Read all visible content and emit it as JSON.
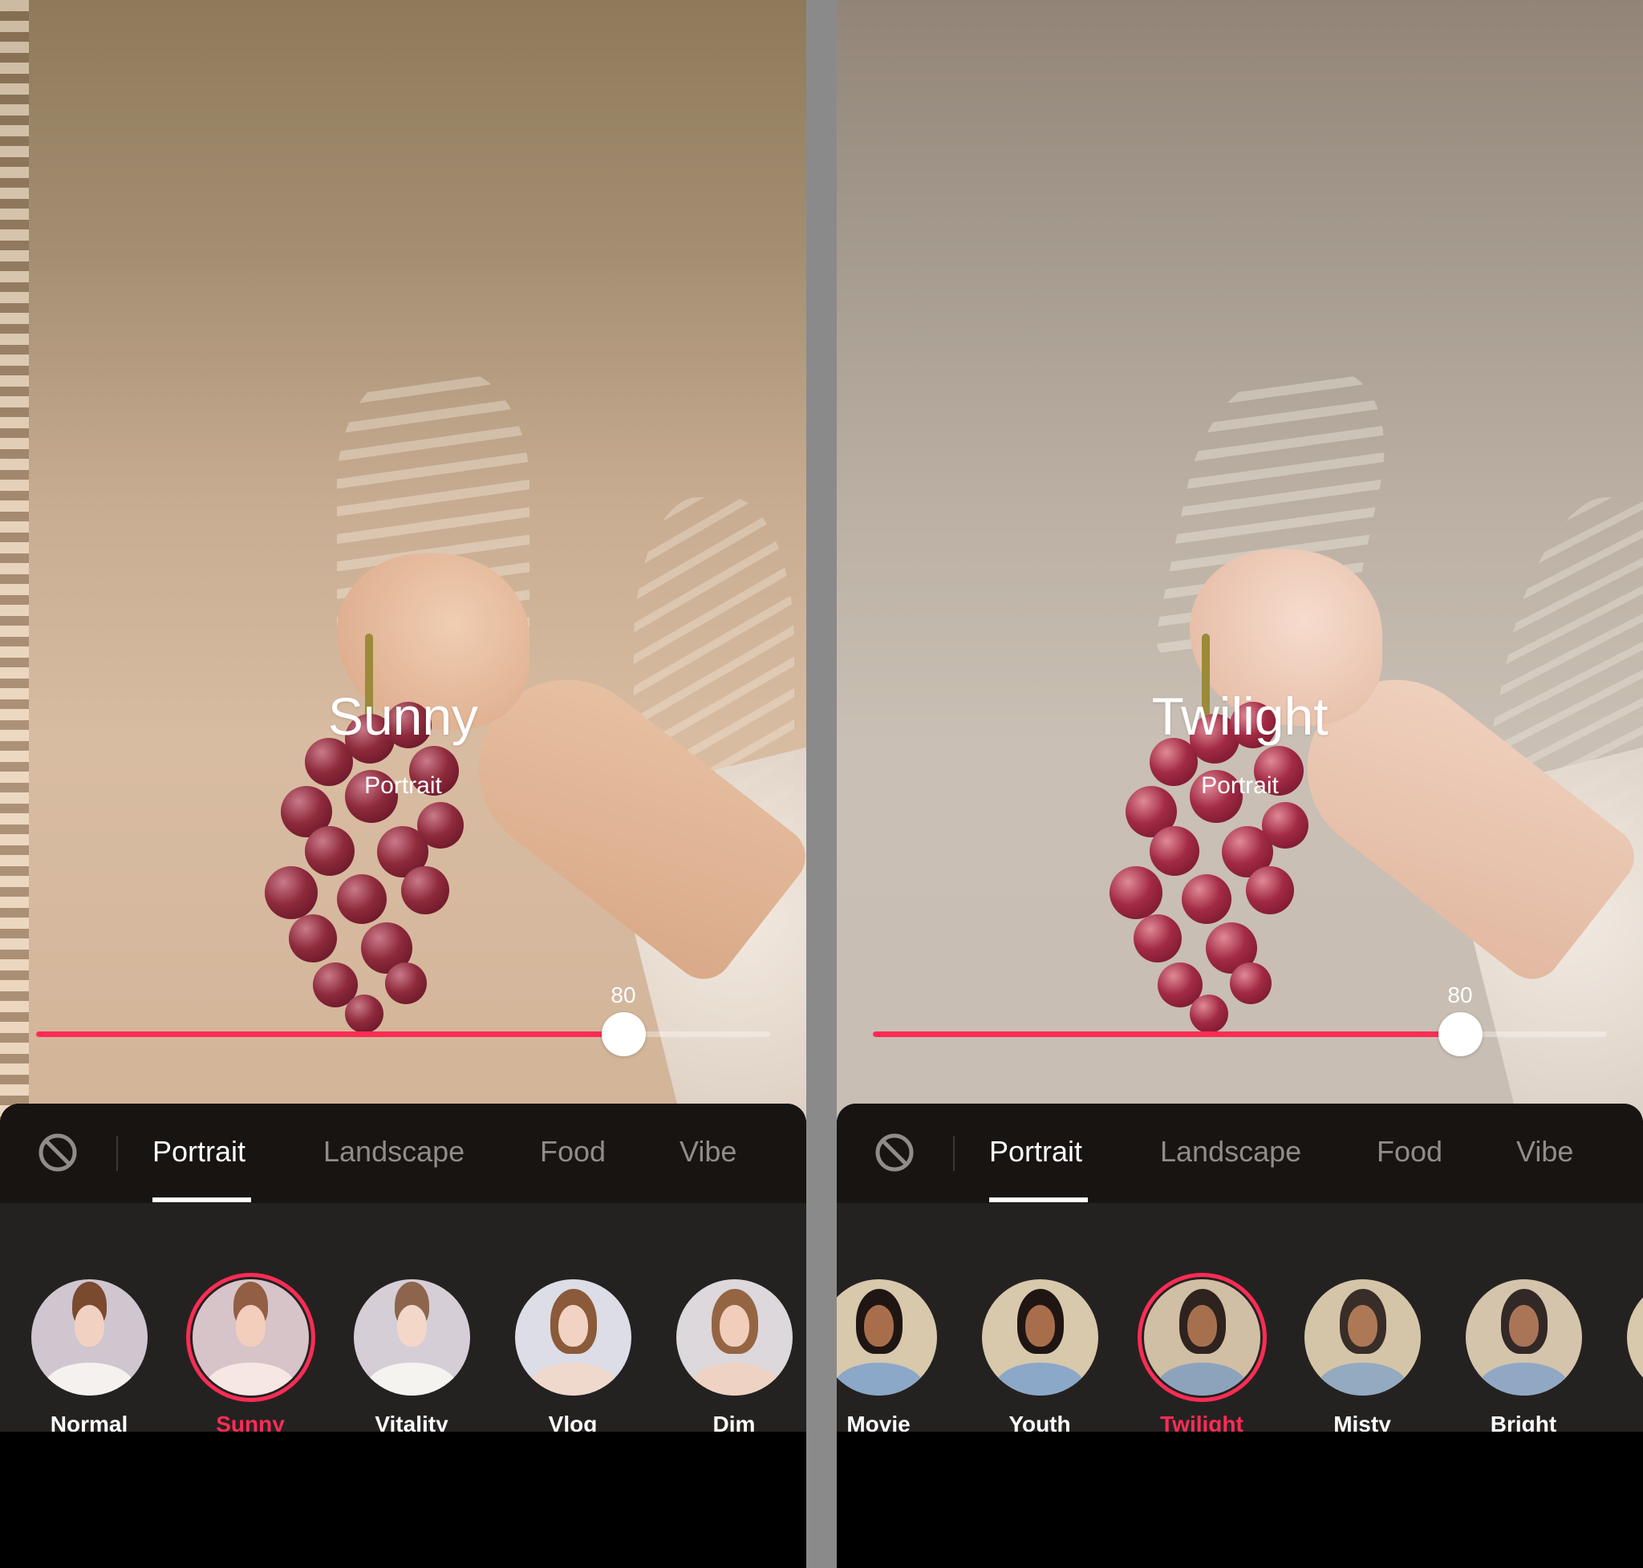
{
  "colors": {
    "accent": "#fe2c55",
    "divider": "#8a8a8a",
    "sheet_header": "#171412",
    "sheet_body": "#242221",
    "tab_inactive": "#8f8c8a",
    "tab_active": "#ffffff"
  },
  "panels": [
    {
      "id": "left",
      "filter_name": "Sunny",
      "filter_category": "Portrait",
      "intensity": 80,
      "intensity_label": "80",
      "tabs": [
        {
          "label": "Portrait",
          "active": true
        },
        {
          "label": "Landscape",
          "active": false
        },
        {
          "label": "Food",
          "active": false
        },
        {
          "label": "Vibe",
          "active": false
        }
      ],
      "no_filter_icon": "prohibit-icon",
      "filters": [
        {
          "label": "Normal",
          "selected": false,
          "thumb": "woman-bun"
        },
        {
          "label": "Sunny",
          "selected": true,
          "thumb": "woman-bun"
        },
        {
          "label": "Vitality",
          "selected": false,
          "thumb": "woman-bun"
        },
        {
          "label": "Vlog",
          "selected": false,
          "thumb": "woman-long-hair"
        },
        {
          "label": "Dim",
          "selected": false,
          "thumb": "woman-long-hair"
        }
      ]
    },
    {
      "id": "right",
      "filter_name": "Twilight",
      "filter_category": "Portrait",
      "intensity": 80,
      "intensity_label": "80",
      "tabs": [
        {
          "label": "Portrait",
          "active": true
        },
        {
          "label": "Landscape",
          "active": false
        },
        {
          "label": "Food",
          "active": false
        },
        {
          "label": "Vibe",
          "active": false
        }
      ],
      "no_filter_icon": "prohibit-icon",
      "filters": [
        {
          "label": "Movie",
          "selected": false,
          "thumb": "man"
        },
        {
          "label": "Youth",
          "selected": false,
          "thumb": "man"
        },
        {
          "label": "Twilight",
          "selected": true,
          "thumb": "man"
        },
        {
          "label": "Misty",
          "selected": false,
          "thumb": "man"
        },
        {
          "label": "Bright",
          "selected": false,
          "thumb": "man"
        },
        {
          "label": "",
          "selected": false,
          "thumb": "man"
        }
      ]
    }
  ]
}
